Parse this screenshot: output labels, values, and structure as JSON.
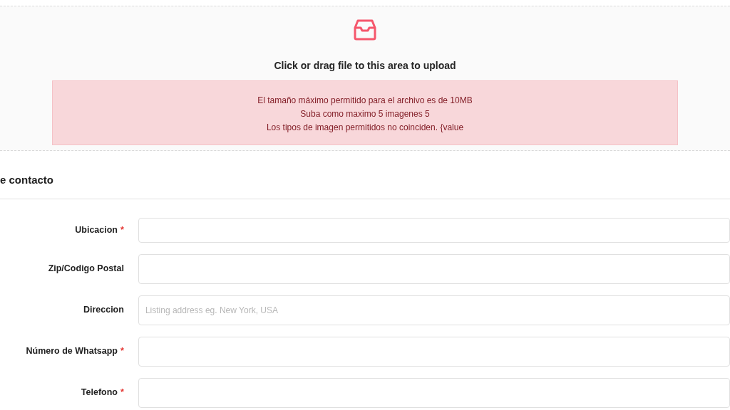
{
  "upload": {
    "prompt": "Click or drag file to this area to upload",
    "errors": [
      "El tamaño máximo permitido para el archivo es de 10MB",
      "Suba como maximo 5 imagenes 5",
      "Los tipos de imagen permitidos no coinciden. {value"
    ]
  },
  "section": {
    "title": "e contacto"
  },
  "fields": [
    {
      "label": "Ubicacion",
      "required_mark": "*"
    },
    {
      "label": "Zip/Codigo Postal"
    },
    {
      "label": "Direccion",
      "placeholder": "Listing address eg. New York, USA"
    },
    {
      "label": "Número de Whatsapp",
      "required_mark": "*"
    },
    {
      "label": "Telefono",
      "required_mark": "*"
    }
  ]
}
